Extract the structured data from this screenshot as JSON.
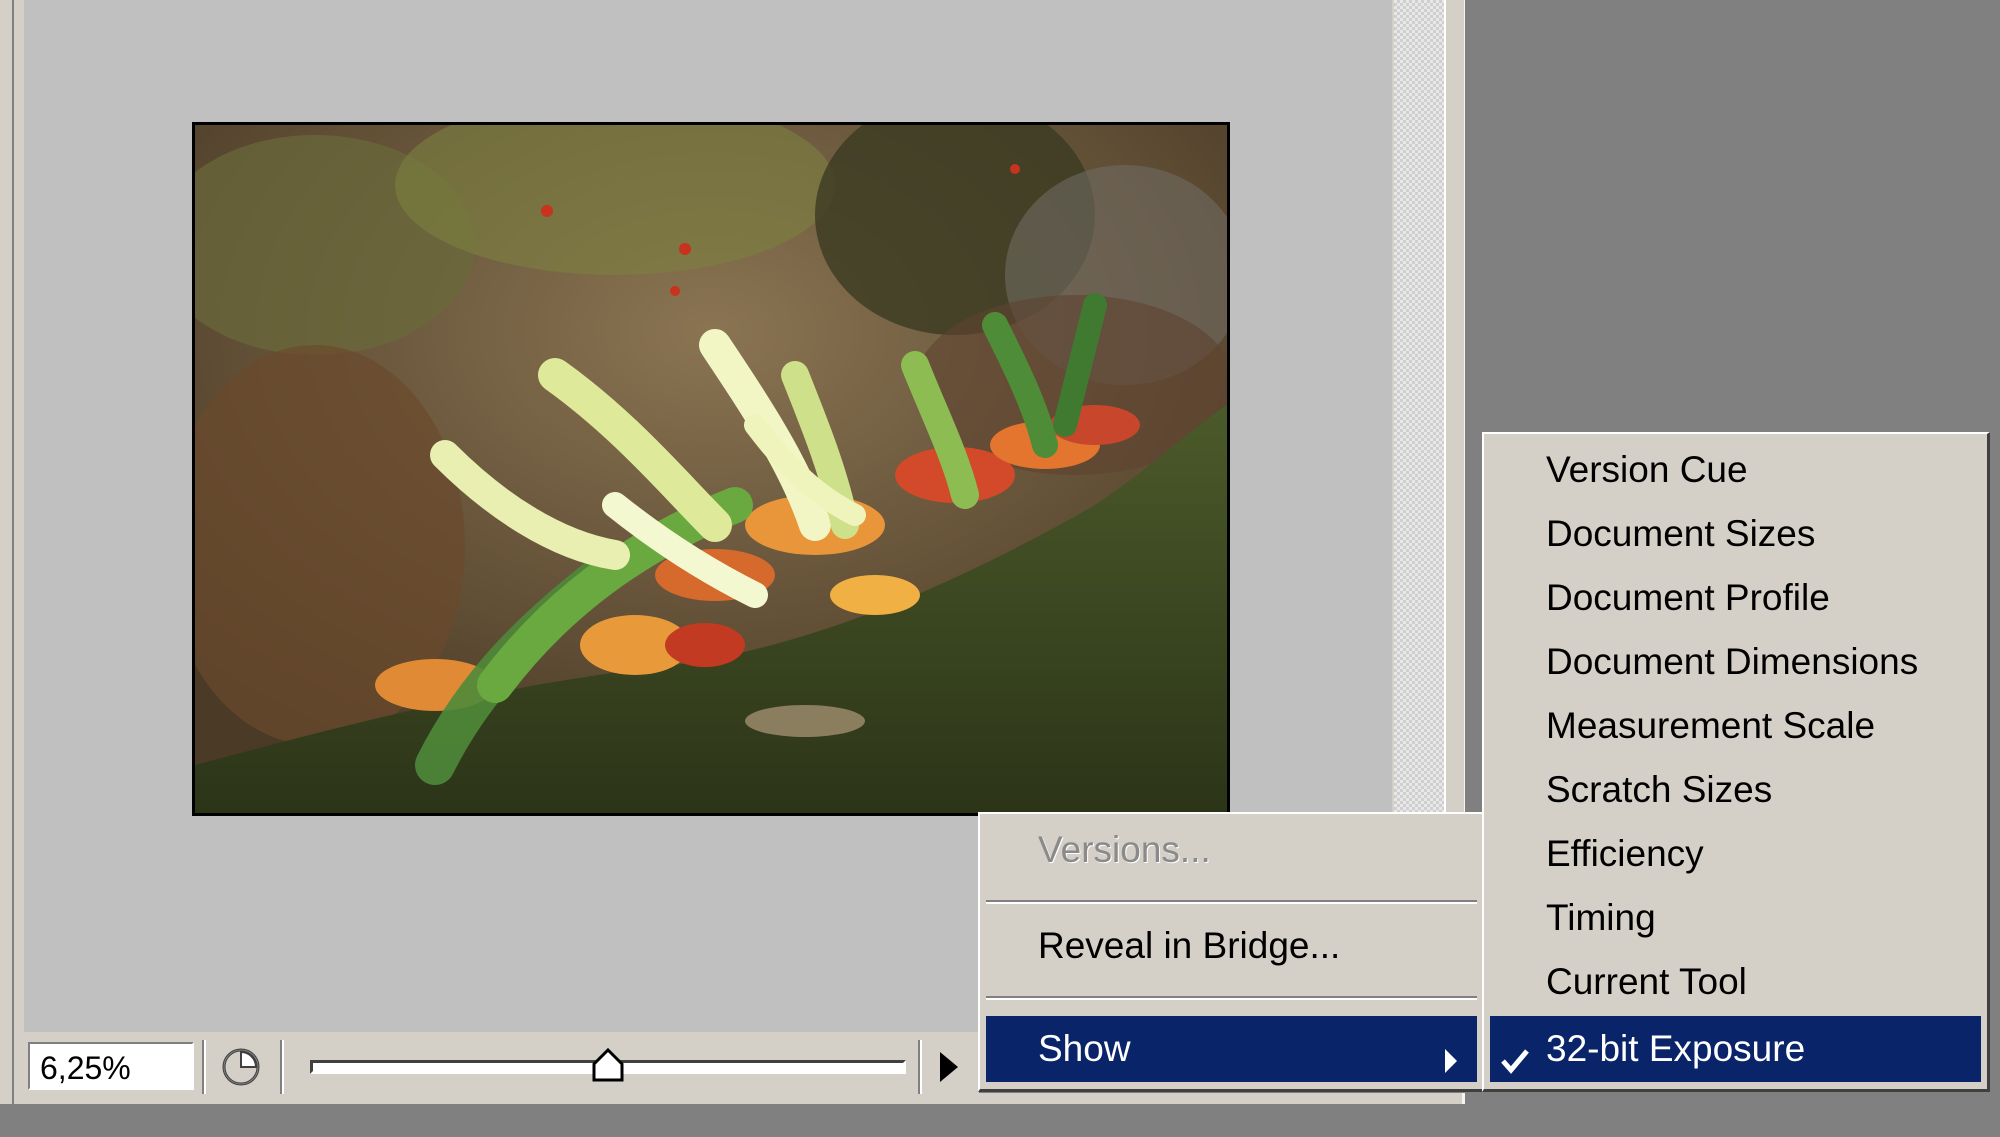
{
  "status_bar": {
    "zoom_value": "6,25%"
  },
  "context_menu": {
    "items": [
      {
        "label": "Versions...",
        "enabled": false
      },
      {
        "label": "Reveal in Bridge...",
        "enabled": true
      },
      {
        "label": "Show",
        "enabled": true,
        "has_submenu": true,
        "highlighted": true
      }
    ]
  },
  "show_submenu": {
    "items": [
      {
        "label": "Version Cue",
        "checked": false
      },
      {
        "label": "Document Sizes",
        "checked": false
      },
      {
        "label": "Document Profile",
        "checked": false
      },
      {
        "label": "Document Dimensions",
        "checked": false
      },
      {
        "label": "Measurement Scale",
        "checked": false
      },
      {
        "label": "Scratch Sizes",
        "checked": false
      },
      {
        "label": "Efficiency",
        "checked": false
      },
      {
        "label": "Timing",
        "checked": false
      },
      {
        "label": "Current Tool",
        "checked": false
      },
      {
        "label": "32-bit Exposure",
        "checked": true
      }
    ]
  },
  "icons": {
    "clock": "clock-icon",
    "slider_thumb": "slider-thumb-icon",
    "status_menu_arrow": "play-arrow-icon",
    "submenu_arrow": "chevron-right-icon",
    "checkmark": "checkmark-icon"
  },
  "exposure_slider": {
    "level_fraction": 0.5
  },
  "colors": {
    "menu_highlight": "#0a246a",
    "menu_background": "#d4d0c8",
    "canvas_background": "#c0c0c0"
  }
}
